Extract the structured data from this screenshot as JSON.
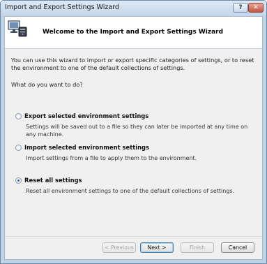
{
  "window": {
    "title": "Import and Export Settings Wizard",
    "help_glyph": "?",
    "close_glyph": "✕"
  },
  "header": {
    "title": "Welcome to the Import and Export Settings Wizard",
    "icon": "wizard-computer-icon"
  },
  "body": {
    "intro": "You can use this wizard to import or export specific categories of settings, or to reset the environment to one of the default collections of settings.",
    "question": "What do you want to do?",
    "options": [
      {
        "label": "Export selected environment settings",
        "description": "Settings will be saved out to a file so they can later be imported at any time on any machine.",
        "selected": false
      },
      {
        "label": "Import selected environment settings",
        "description": "Import settings from a file to apply them to the environment.",
        "selected": false
      },
      {
        "label": "Reset all settings",
        "description": "Reset all environment settings to one of the default collections of settings.",
        "selected": true
      }
    ]
  },
  "footer": {
    "previous": "< Previous",
    "next": "Next >",
    "finish": "Finish",
    "cancel": "Cancel"
  },
  "colors": {
    "frame": "#bfd3e8",
    "radio_selected": "#2f6aa8",
    "default_button_border": "#3c7fb1"
  }
}
